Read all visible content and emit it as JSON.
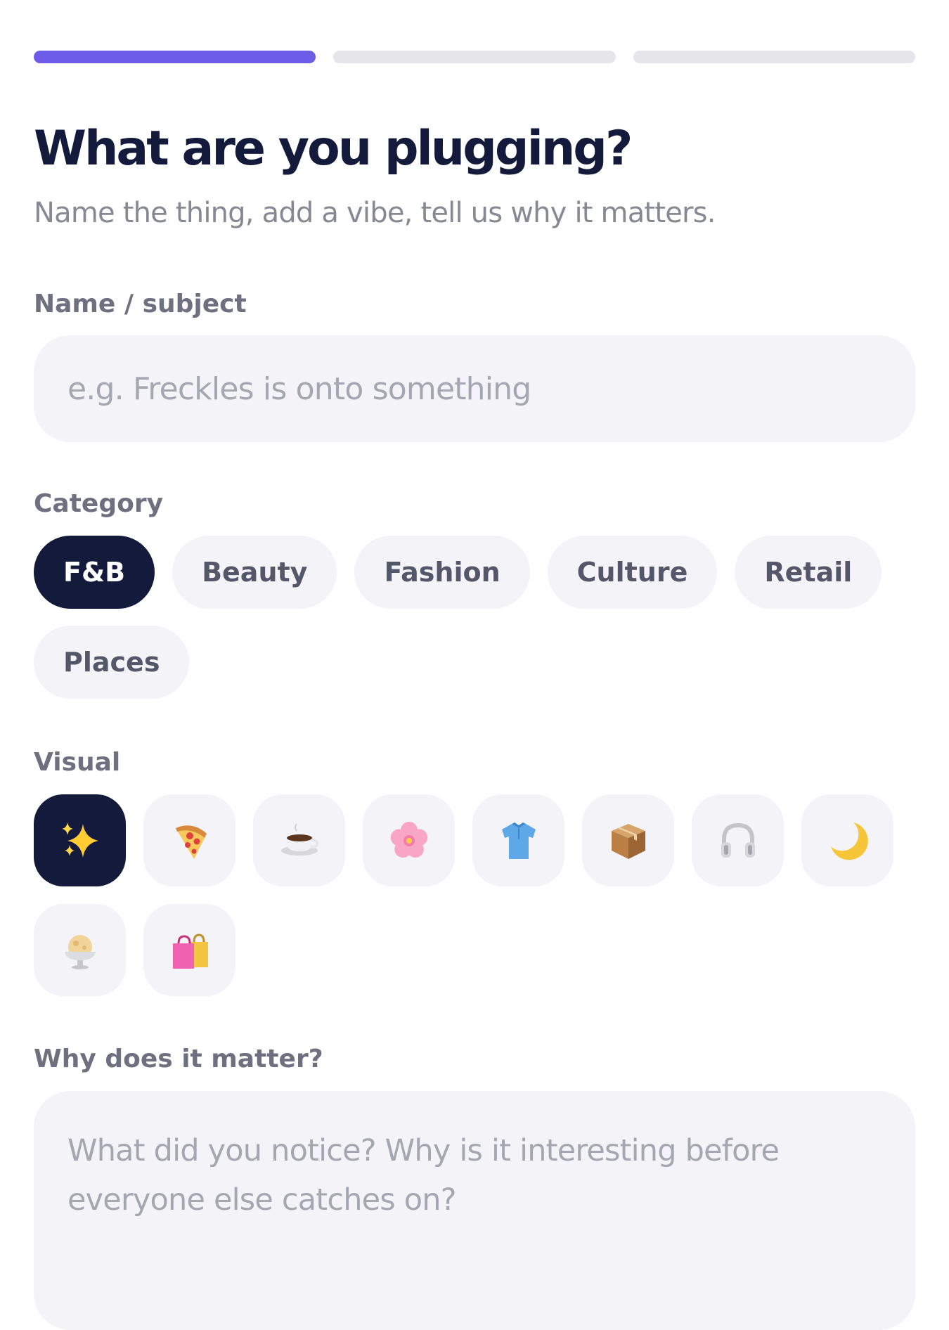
{
  "progress": {
    "current_step": 1,
    "total_steps": 3,
    "colors": {
      "active": "#6c5ce7",
      "inactive": "#e6e6ea"
    }
  },
  "header": {
    "title": "What are you plugging?",
    "subtitle": "Name the thing, add a vibe, tell us why it matters."
  },
  "name_field": {
    "label": "Name / subject",
    "value": "",
    "placeholder": "e.g. Freckles is onto something"
  },
  "category": {
    "label": "Category",
    "selected": "F&B",
    "options": [
      "F&B",
      "Beauty",
      "Fashion",
      "Culture",
      "Retail",
      "Places"
    ]
  },
  "visual": {
    "label": "Visual",
    "selected": "sparkles-icon",
    "icons": [
      "sparkles-icon",
      "pizza-icon",
      "coffee-icon",
      "cherry-blossom-icon",
      "shirt-icon",
      "package-icon",
      "headphones-icon",
      "crescent-moon-icon",
      "ice-cream-icon",
      "shopping-bags-icon"
    ]
  },
  "why_field": {
    "label": "Why does it matter?",
    "value": "",
    "placeholder": "What did you notice? Why is it interesting before everyone else catches on?"
  },
  "colors": {
    "navy": "#131a3c",
    "accent": "#6c5ce7",
    "field_bg": "#f4f4f8",
    "muted_text": "#868894"
  }
}
